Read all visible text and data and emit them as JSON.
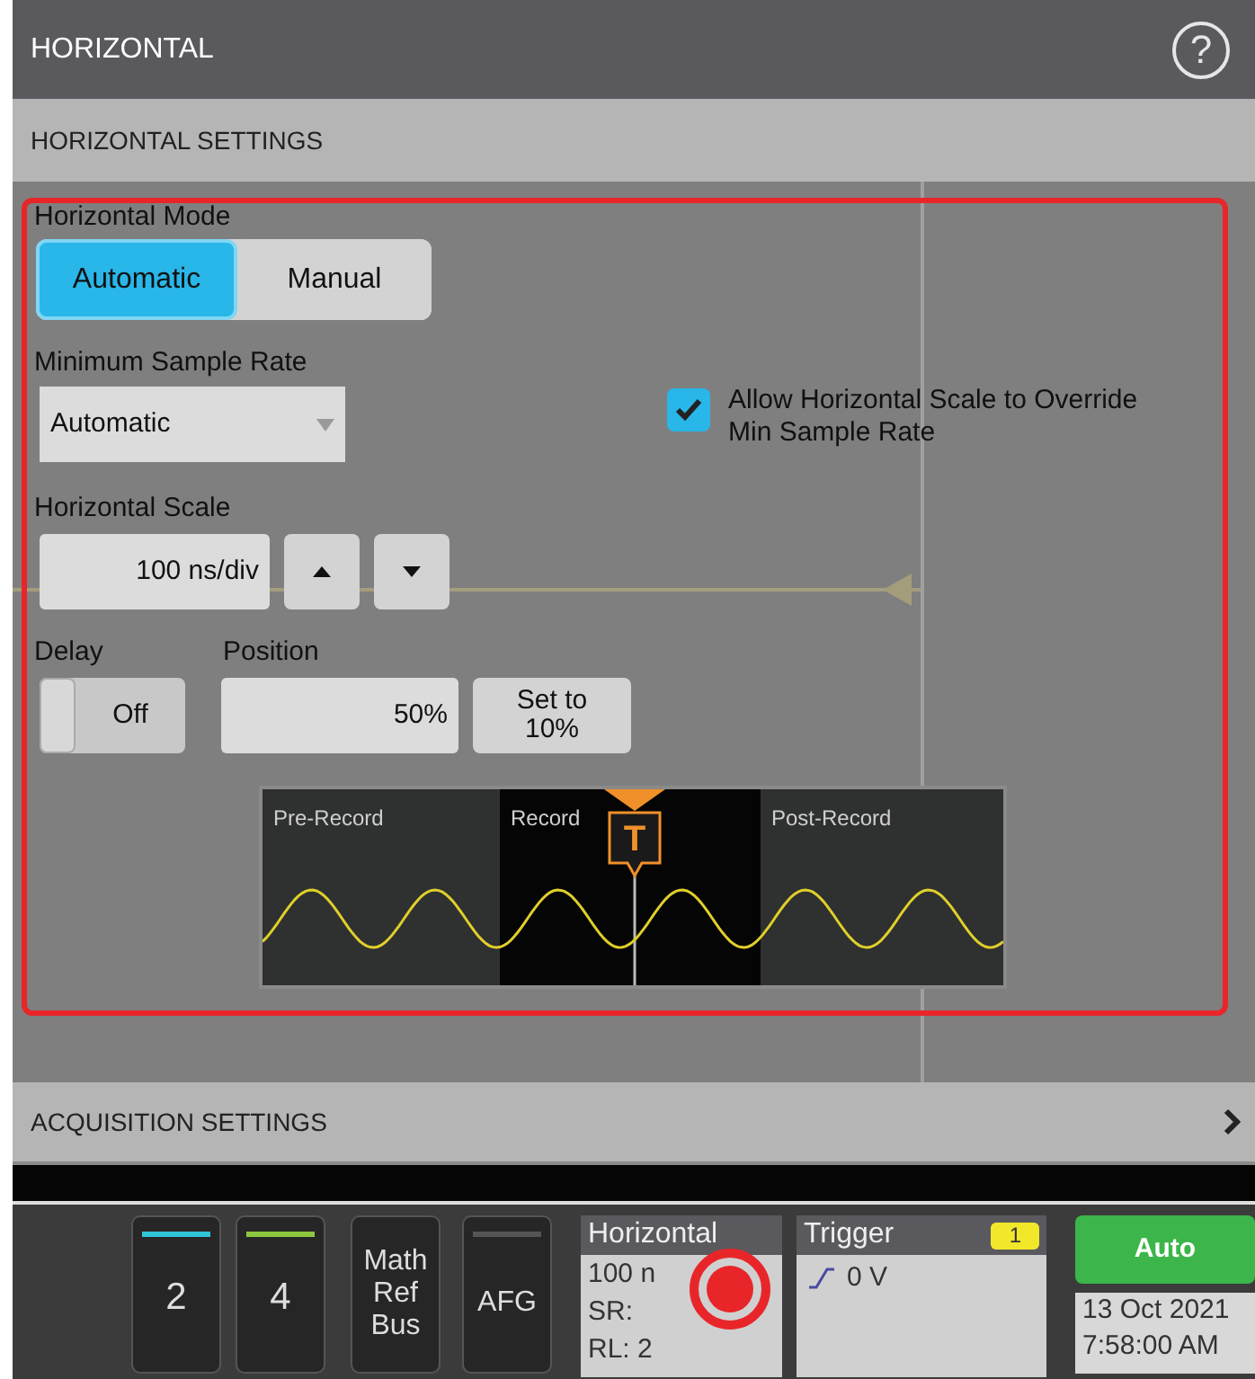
{
  "window": {
    "title": "HORIZONTAL",
    "help": "?"
  },
  "sections": [
    {
      "title": "HORIZONTAL SETTINGS",
      "expanded": true
    },
    {
      "title": "ACQUISITION SETTINGS",
      "expanded": false
    }
  ],
  "horizontal_mode": {
    "label": "Horizontal Mode",
    "options": [
      {
        "label": "Automatic",
        "selected": true
      },
      {
        "label": "Manual",
        "selected": false
      }
    ]
  },
  "min_sample_rate": {
    "label": "Minimum Sample Rate",
    "value": "Automatic"
  },
  "override": {
    "label": "Allow Horizontal Scale to Override Min Sample Rate",
    "checked": true
  },
  "horizontal_scale": {
    "label": "Horizontal Scale",
    "value": "100 ns/div"
  },
  "delay": {
    "label": "Delay",
    "value": "Off",
    "on": false
  },
  "position": {
    "label": "Position",
    "value": "50%",
    "button": "Set to 10%"
  },
  "record_diagram": {
    "regions": [
      "Pre-Record",
      "Record",
      "Post-Record"
    ],
    "trigger": "T"
  },
  "bottom_bar": {
    "channels": [
      {
        "label": "2",
        "color": "#2fc6d8"
      },
      {
        "label": "4",
        "color": "#8fc63f"
      }
    ],
    "math_ref_bus": [
      "Math",
      "Ref",
      "Bus"
    ],
    "afg": "AFG",
    "horizontal": {
      "title": "Horizontal",
      "lines": [
        "100 n",
        "SR:",
        "RL: 2"
      ]
    },
    "trigger": {
      "title": "Trigger",
      "badge": "1",
      "level": "0 V"
    },
    "acquisition": "Auto",
    "date": "13 Oct 2021",
    "time": "7:58:00 AM"
  }
}
